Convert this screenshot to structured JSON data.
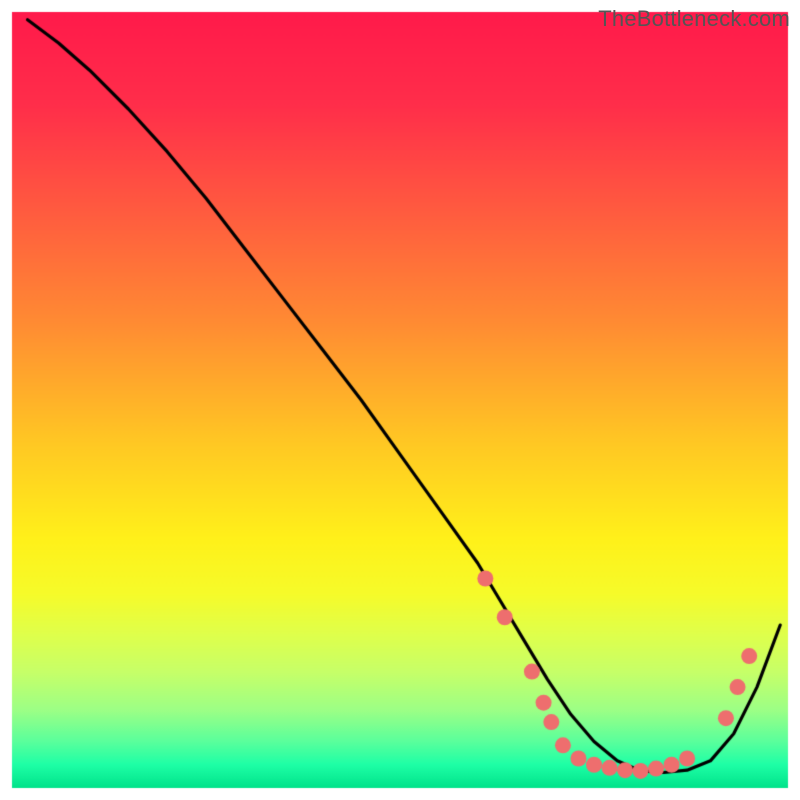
{
  "watermark": "TheBottleneck.com",
  "chart_data": {
    "type": "line",
    "title": "",
    "xlabel": "",
    "ylabel": "",
    "xlim": [
      0,
      100
    ],
    "ylim": [
      0,
      100
    ],
    "gradient_stops": [
      {
        "pos": 0.0,
        "color": "#ff1a4b"
      },
      {
        "pos": 0.12,
        "color": "#ff2e4a"
      },
      {
        "pos": 0.25,
        "color": "#ff5940"
      },
      {
        "pos": 0.4,
        "color": "#ff8b33"
      },
      {
        "pos": 0.55,
        "color": "#ffc624"
      },
      {
        "pos": 0.68,
        "color": "#fff11a"
      },
      {
        "pos": 0.75,
        "color": "#f6fb2a"
      },
      {
        "pos": 0.8,
        "color": "#e0ff4a"
      },
      {
        "pos": 0.85,
        "color": "#c7ff68"
      },
      {
        "pos": 0.9,
        "color": "#9cff86"
      },
      {
        "pos": 0.94,
        "color": "#5aff9c"
      },
      {
        "pos": 0.97,
        "color": "#1effa6"
      },
      {
        "pos": 1.0,
        "color": "#00e38a"
      }
    ],
    "series": [
      {
        "name": "bottleneck-curve",
        "x": [
          2,
          6,
          10,
          15,
          20,
          25,
          30,
          35,
          40,
          45,
          50,
          55,
          60,
          63,
          66,
          69,
          72,
          75,
          78,
          81,
          84,
          87,
          90,
          93,
          96,
          99
        ],
        "y": [
          99,
          96,
          92.5,
          87.5,
          82,
          76,
          69.5,
          63,
          56.5,
          50,
          43,
          36,
          29,
          24,
          19,
          14,
          9.5,
          6,
          3.5,
          2.2,
          2,
          2.3,
          3.5,
          7,
          13,
          21
        ]
      }
    ],
    "markers": {
      "name": "highlight-dots",
      "color": "#ee6e6e",
      "radius": 8,
      "points": [
        {
          "x": 61,
          "y": 27
        },
        {
          "x": 63.5,
          "y": 22
        },
        {
          "x": 67,
          "y": 15
        },
        {
          "x": 68.5,
          "y": 11
        },
        {
          "x": 69.5,
          "y": 8.5
        },
        {
          "x": 71,
          "y": 5.5
        },
        {
          "x": 73,
          "y": 3.8
        },
        {
          "x": 75,
          "y": 3
        },
        {
          "x": 77,
          "y": 2.6
        },
        {
          "x": 79,
          "y": 2.3
        },
        {
          "x": 81,
          "y": 2.2
        },
        {
          "x": 83,
          "y": 2.5
        },
        {
          "x": 85,
          "y": 3
        },
        {
          "x": 87,
          "y": 3.8
        },
        {
          "x": 92,
          "y": 9
        },
        {
          "x": 93.5,
          "y": 13
        },
        {
          "x": 95,
          "y": 17
        }
      ]
    },
    "border": {
      "color": "#ffffff",
      "width": 2
    }
  }
}
